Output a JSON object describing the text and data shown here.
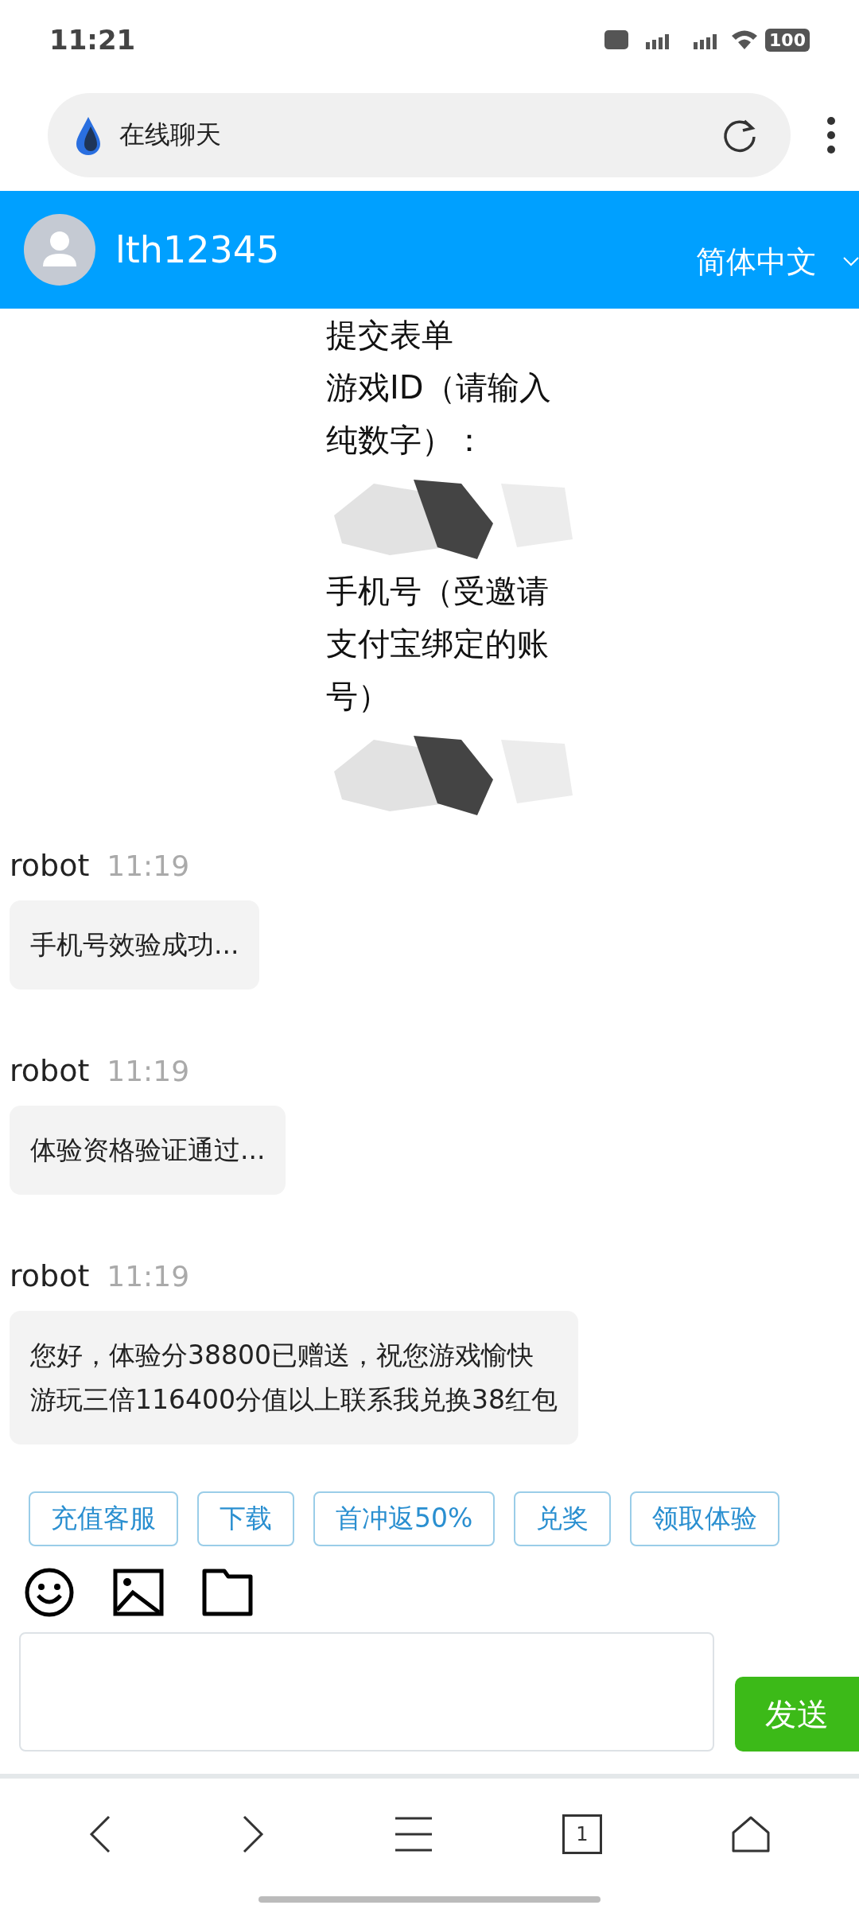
{
  "status_bar": {
    "time": "11:21",
    "battery": "100"
  },
  "browser": {
    "title": "在线聊天",
    "tabs_count": "1"
  },
  "header": {
    "username": "lth12345",
    "language": "简体中文"
  },
  "form_message": {
    "lines": [
      {
        "text": "提交表单",
        "kind": "text"
      },
      {
        "text": "游戏ID（请输入",
        "kind": "text"
      },
      {
        "text": "纯数字）：",
        "kind": "text"
      },
      {
        "kind": "redacted"
      },
      {
        "text": "手机号（受邀请",
        "kind": "text"
      },
      {
        "text": "支付宝绑定的账",
        "kind": "text"
      },
      {
        "text": "号）",
        "kind": "text"
      },
      {
        "kind": "redacted"
      }
    ]
  },
  "messages": [
    {
      "sender": "robot",
      "time": "11:19",
      "lines": [
        "手机号效验成功..."
      ]
    },
    {
      "sender": "robot",
      "time": "11:19",
      "lines": [
        "体验资格验证通过..."
      ]
    },
    {
      "sender": "robot",
      "time": "11:19",
      "lines": [
        "您好，体验分38800已赠送，祝您游戏愉快",
        "游玩三倍116400分值以上联系我兑换38红包"
      ]
    }
  ],
  "quick_buttons": [
    "充值客服",
    "下载",
    "首冲返50%",
    "兑奖",
    "领取体验"
  ],
  "send_button": "发送"
}
